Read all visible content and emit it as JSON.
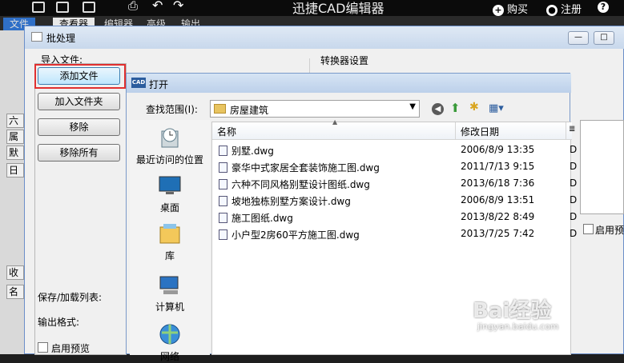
{
  "app": {
    "title": "迅捷CAD编辑器",
    "buy_label": "购买",
    "register_label": "注册",
    "ribbon_tabs": [
      "文件",
      "查看器",
      "编辑器",
      "高级",
      "输出"
    ]
  },
  "left_panel": {
    "tab_labels": [
      "六",
      "属",
      "默",
      "日",
      "收",
      "名"
    ]
  },
  "batch_dialog": {
    "title": "批处理",
    "import_label": "导入文件:",
    "converter_label": "转换器设置",
    "buttons": {
      "add_file": "添加文件",
      "add_folder": "加入文件夹",
      "remove": "移除",
      "remove_all": "移除所有"
    },
    "save_load_label": "保存/加载列表:",
    "output_format_label": "输出格式:",
    "enable_preview_label": "启用预览",
    "enable_preview_right_label": "启用预",
    "win_controls": [
      "—",
      "□",
      "✕"
    ]
  },
  "open_dialog": {
    "title": "打开",
    "cad_badge": "CAD",
    "look_in_label": "查找范围(I):",
    "look_in_value": "房屋建筑",
    "places": [
      {
        "icon": "recent-places-icon",
        "label": "最近访问的位置"
      },
      {
        "icon": "desktop-icon",
        "label": "桌面"
      },
      {
        "icon": "library-icon",
        "label": "库"
      },
      {
        "icon": "computer-icon",
        "label": "计算机"
      },
      {
        "icon": "network-icon",
        "label": "网络"
      }
    ],
    "columns": {
      "name": "名称",
      "modified": "修改日期",
      "extra": "≣"
    },
    "files": [
      {
        "name": "别墅.dwg",
        "modified": "2006/8/9 13:35",
        "type": "D"
      },
      {
        "name": "豪华中式家居全套装饰施工图.dwg",
        "modified": "2011/7/13 9:15",
        "type": "D"
      },
      {
        "name": "六种不同风格别墅设计图纸.dwg",
        "modified": "2013/6/18 7:36",
        "type": "D"
      },
      {
        "name": "坡地独栋别墅方案设计.dwg",
        "modified": "2006/8/9 13:51",
        "type": "D"
      },
      {
        "name": "施工图纸.dwg",
        "modified": "2013/8/22 8:49",
        "type": "D"
      },
      {
        "name": "小户型2房60平方施工图.dwg",
        "modified": "2013/7/25 7:42",
        "type": "D"
      }
    ]
  },
  "highlight_color": "#e03030",
  "watermark": {
    "text": "Bai经验",
    "url": "jingyan.baidu.com"
  }
}
